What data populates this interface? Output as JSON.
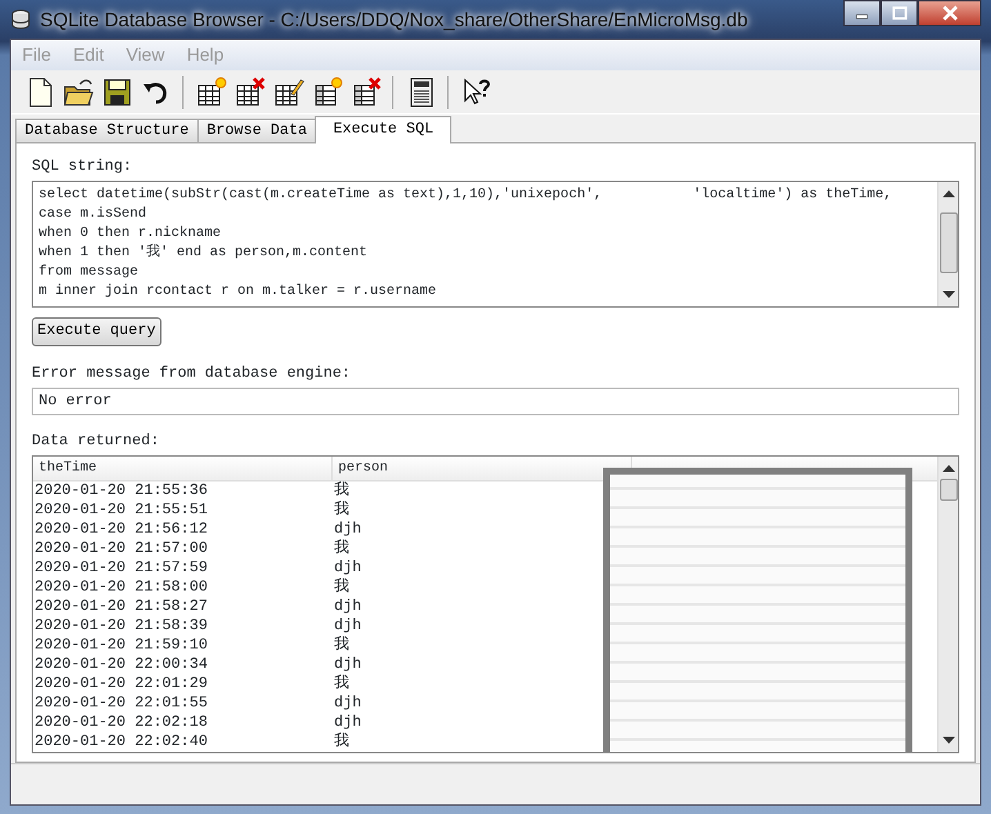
{
  "window": {
    "title": "SQLite Database Browser - C:/Users/DDQ/Nox_share/OtherShare/EnMicroMsg.db"
  },
  "menu": [
    "File",
    "Edit",
    "View",
    "Help"
  ],
  "toolbar": [
    {
      "kind": "new"
    },
    {
      "kind": "open"
    },
    {
      "kind": "save"
    },
    {
      "kind": "undo"
    },
    {
      "kind": "sep"
    },
    {
      "kind": "table-add"
    },
    {
      "kind": "table-delete"
    },
    {
      "kind": "table-edit"
    },
    {
      "kind": "index-add"
    },
    {
      "kind": "index-delete"
    },
    {
      "kind": "sep"
    },
    {
      "kind": "log"
    },
    {
      "kind": "sep"
    },
    {
      "kind": "help"
    }
  ],
  "tabs": [
    {
      "label": "Database Structure",
      "selected": false
    },
    {
      "label": "Browse Data",
      "selected": false
    },
    {
      "label": "Execute SQL",
      "selected": true
    }
  ],
  "sql": {
    "label": "SQL string:",
    "lines": [
      "select datetime(subStr(cast(m.createTime as text),1,10),'unixepoch',           'localtime') as theTime,",
      "case m.isSend",
      "when 0 then r.nickname",
      "when 1 then '我' end as person,m.content",
      "from message",
      "m inner join rcontact r on m.talker = r.username"
    ]
  },
  "execute_button": "Execute query",
  "error": {
    "label": "Error message from database engine:",
    "value": "No error"
  },
  "results": {
    "label": "Data returned:",
    "columns": [
      "theTime",
      "person"
    ],
    "rows": [
      {
        "theTime": "2020-01-20 21:55:36",
        "person": "我"
      },
      {
        "theTime": "2020-01-20 21:55:51",
        "person": "我"
      },
      {
        "theTime": "2020-01-20 21:56:12",
        "person": "djh"
      },
      {
        "theTime": "2020-01-20 21:57:00",
        "person": "我"
      },
      {
        "theTime": "2020-01-20 21:57:59",
        "person": "djh"
      },
      {
        "theTime": "2020-01-20 21:58:00",
        "person": "我"
      },
      {
        "theTime": "2020-01-20 21:58:27",
        "person": "djh"
      },
      {
        "theTime": "2020-01-20 21:58:39",
        "person": "djh"
      },
      {
        "theTime": "2020-01-20 21:59:10",
        "person": "我"
      },
      {
        "theTime": "2020-01-20 22:00:34",
        "person": "djh"
      },
      {
        "theTime": "2020-01-20 22:01:29",
        "person": "我"
      },
      {
        "theTime": "2020-01-20 22:01:55",
        "person": "djh"
      },
      {
        "theTime": "2020-01-20 22:02:18",
        "person": "djh"
      },
      {
        "theTime": "2020-01-20 22:02:40",
        "person": "我"
      }
    ]
  }
}
